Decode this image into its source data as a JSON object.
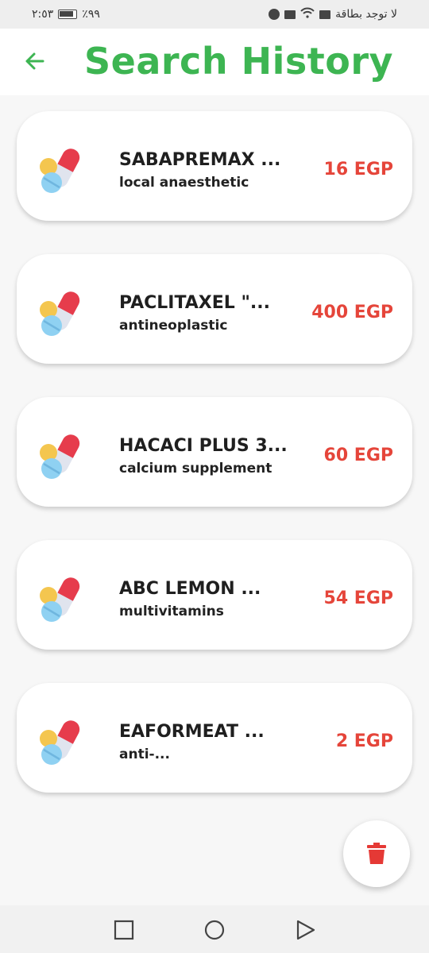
{
  "status_bar": {
    "time": "٢:٥٣",
    "battery": "٪٩٩",
    "carrier": "لا توجد بطاقة"
  },
  "header": {
    "title": "Search History"
  },
  "history": [
    {
      "name": "SABAPREMAX ...",
      "category": "local anaesthetic",
      "price": "16 EGP"
    },
    {
      "name": "PACLITAXEL \"...",
      "category": "antineoplastic",
      "price": "400 EGP"
    },
    {
      "name": "HACACI PLUS 3...",
      "category": "calcium supplement",
      "price": "60 EGP"
    },
    {
      "name": "ABC LEMON ...",
      "category": "multivitamins",
      "price": "54 EGP"
    },
    {
      "name": "EAFORMEAT ...",
      "category": "anti-...",
      "price": "2 EGP"
    }
  ],
  "colors": {
    "title_green": "#3db552",
    "price_red": "#e5453a",
    "delete_red": "#e53935"
  },
  "icons": {
    "back": "arrow-left-icon",
    "item": "pills-icon",
    "delete": "trash-icon",
    "nav_recents": "square-icon",
    "nav_home": "circle-icon",
    "nav_back": "triangle-icon"
  }
}
